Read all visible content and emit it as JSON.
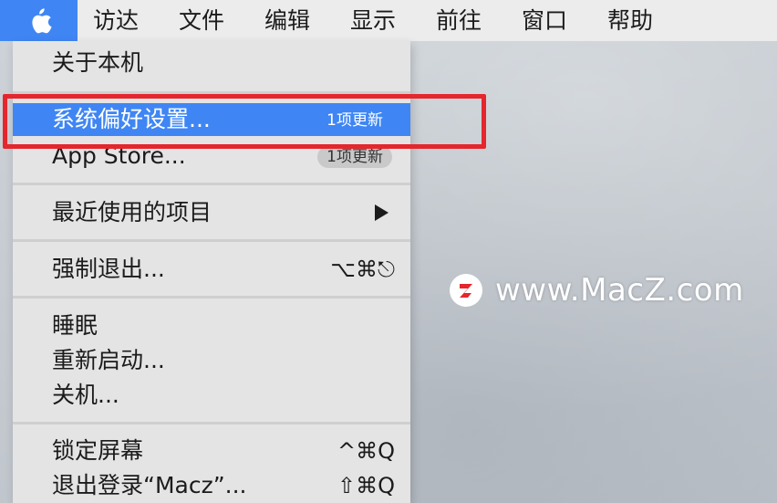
{
  "menubar": {
    "apple_icon": "apple-logo-icon",
    "items": [
      "访达",
      "文件",
      "编辑",
      "显示",
      "前往",
      "窗口",
      "帮助"
    ]
  },
  "dropdown": {
    "about": "关于本机",
    "system_prefs": {
      "label": "系统偏好设置...",
      "badge": "1项更新"
    },
    "app_store": {
      "label": "App Store...",
      "badge": "1项更新"
    },
    "recent_items": {
      "label": "最近使用的项目",
      "submenu_icon": "triangle-right-icon"
    },
    "force_quit": {
      "label": "强制退出...",
      "shortcut": "⌥⌘⎋"
    },
    "sleep": "睡眠",
    "restart": "重新启动...",
    "shutdown": "关机...",
    "lock_screen": {
      "label": "锁定屏幕",
      "shortcut": "^⌘Q"
    },
    "logout": {
      "label": "退出登录“Macz”...",
      "shortcut": "⇧⌘Q"
    }
  },
  "watermark": {
    "text": "www.MacZ.com",
    "logo_icon": "z-logo-icon"
  },
  "colors": {
    "highlight": "#3f86f4",
    "annotation": "#e5262c",
    "menu_background": "#e4e4e4",
    "menubar_background": "#ececec"
  }
}
